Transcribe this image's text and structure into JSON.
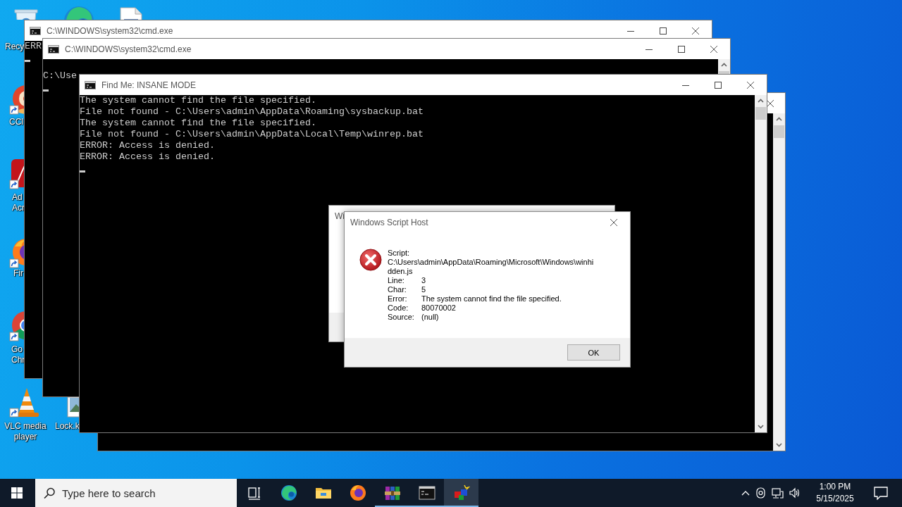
{
  "desktop_icons": [
    {
      "kind": "recycle-bin",
      "label_lines": [
        "Recy"
      ]
    },
    {
      "kind": "edge"
    },
    {
      "kind": "document"
    },
    {
      "kind": "ccleaner",
      "label_lines": [
        "CCl"
      ]
    },
    {
      "kind": "acrobat",
      "label_lines": [
        "Ad",
        "Acr"
      ]
    },
    {
      "kind": "firefox",
      "label_lines": [
        "Fir"
      ]
    },
    {
      "kind": "chrome",
      "label_lines": [
        "Go",
        "Chr"
      ]
    },
    {
      "kind": "vlc",
      "label_lines": [
        "VLC media",
        "player"
      ]
    },
    {
      "kind": "image",
      "label_lines": [
        "Lock.k"
      ]
    }
  ],
  "windows": [
    {
      "title": "C:\\WINDOWS\\system32\\cmd.exe",
      "title_buttons": [
        {
          "kind": "minimize"
        },
        {
          "kind": "maximize"
        },
        {
          "kind": "close"
        }
      ],
      "lines": [
        "ERR"
      ],
      "cursor": true
    },
    {
      "title": "C:\\WINDOWS\\system32\\cmd.exe",
      "title_buttons": [
        {
          "kind": "minimize"
        },
        {
          "kind": "maximize"
        },
        {
          "kind": "close"
        }
      ],
      "lines": [
        "C:\\Use"
      ],
      "cursor": true,
      "scrollbar": true
    },
    {
      "title_buttons": [
        {
          "kind": "close"
        }
      ],
      "scrollbar": true
    },
    {
      "title": "Find Me: INSANE MODE",
      "title_buttons": [
        {
          "kind": "minimize"
        },
        {
          "kind": "maximize"
        },
        {
          "kind": "close"
        }
      ],
      "lines": [
        "The system cannot find the file specified.",
        "File not found - C:\\Users\\admin\\AppData\\Roaming\\sysbackup.bat",
        "The system cannot find the file specified.",
        "File not found - C:\\Users\\admin\\AppData\\Local\\Temp\\winrep.bat",
        "ERROR: Access is denied.",
        "ERROR: Access is denied."
      ],
      "cursor": true,
      "scrollbar": true
    }
  ],
  "dialogs": [
    {
      "title": "Wi"
    },
    {
      "title": "Windows Script Host",
      "title_buttons": [
        {
          "kind": "close"
        }
      ],
      "fields": [
        {
          "kind": "block",
          "label": "Script:",
          "value": "C:\\Users\\admin\\AppData\\Roaming\\Microsoft\\Windows\\winhidden.js"
        },
        {
          "kind": "row",
          "label": "Line:",
          "value": "3"
        },
        {
          "kind": "row",
          "label": "Char:",
          "value": "5"
        },
        {
          "kind": "row",
          "label": "Error:",
          "value": "The system cannot find the file specified."
        },
        {
          "kind": "row",
          "label": "Code:",
          "value": "80070002"
        },
        {
          "kind": "row",
          "label": "Source:",
          "value": "(null)"
        }
      ],
      "buttons": [
        {
          "label": "OK"
        }
      ]
    }
  ],
  "taskbar": {
    "search": {
      "placeholder": "Type here to search"
    },
    "apps": [
      {
        "kind": "edge",
        "running": false,
        "selected": false
      },
      {
        "kind": "explorer",
        "running": false,
        "selected": false
      },
      {
        "kind": "firefox",
        "running": false,
        "selected": false
      },
      {
        "kind": "winrar",
        "running": true,
        "selected": false
      },
      {
        "kind": "terminal",
        "running": true,
        "selected": false
      },
      {
        "kind": "cubes",
        "running": true,
        "selected": true
      }
    ],
    "clock": {
      "time": "1:00 PM",
      "date": "5/15/2025"
    }
  }
}
